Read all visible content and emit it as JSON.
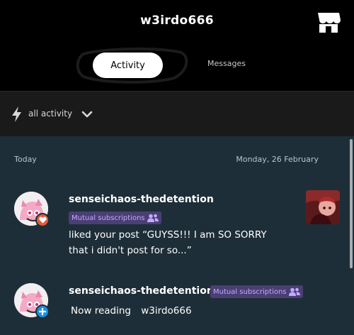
{
  "header": {
    "title": "w3irdo666",
    "shop_icon": "store-icon"
  },
  "tabs": [
    {
      "label": "Activity",
      "selected": true
    },
    {
      "label": "Messages",
      "selected": false
    }
  ],
  "filter": {
    "icon": "bolt-icon",
    "label": "all activity",
    "dropdown_icon": "chevron-down-icon"
  },
  "feed": {
    "day_label": "Today",
    "date_label": "Monday, 26 February",
    "items": [
      {
        "username": "senseichaos-thedetention",
        "mutual_label": "Mutual subscriptions",
        "badge_icon": "heart-icon",
        "badge_color": "#e35a3d",
        "message_line1": "liked your post “GUYSS!!! I am SO SORRY",
        "message_line2": "that i didn't post for so...”"
      },
      {
        "username": "senseichaos-thedetention",
        "mutual_label": "Mutual subscriptions",
        "badge_icon": "plus-icon",
        "badge_color": "#1f8fe6",
        "message_prefix": "Now reading",
        "message_target": "w3irdo666"
      }
    ]
  },
  "colors": {
    "header_bg": "#000000",
    "filter_bg": "#1a1a1a",
    "feed_bg": "#1e2e38",
    "mutual_bg": "#4a3f73",
    "mutual_text": "#c3a8ff"
  }
}
